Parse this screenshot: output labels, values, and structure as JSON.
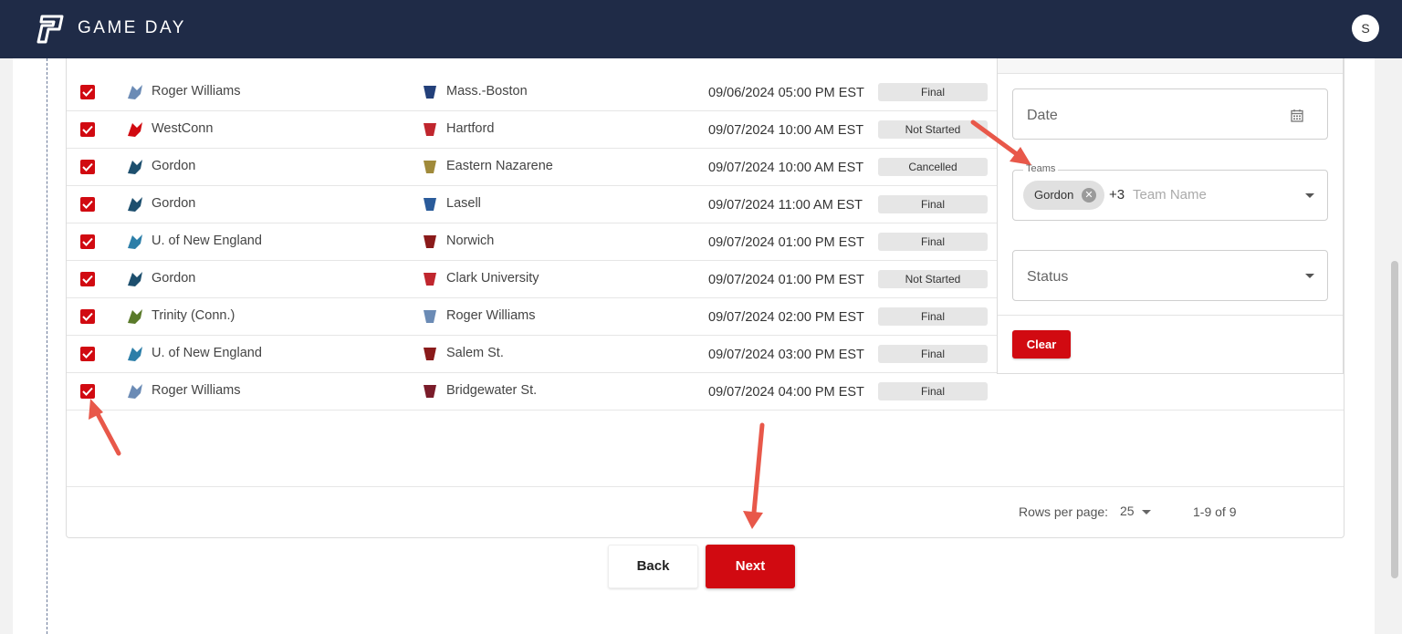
{
  "header": {
    "title": "GAME DAY",
    "avatar_initial": "S"
  },
  "games": [
    {
      "team1": "Roger Williams",
      "team2": "Mass.-Boston",
      "datetime": "09/06/2024 05:00 PM EST",
      "status": "Final",
      "checked": true
    },
    {
      "team1": "WestConn",
      "team2": "Hartford",
      "datetime": "09/07/2024 10:00 AM EST",
      "status": "Not Started",
      "checked": true
    },
    {
      "team1": "Gordon",
      "team2": "Eastern Nazarene",
      "datetime": "09/07/2024 10:00 AM EST",
      "status": "Cancelled",
      "checked": true
    },
    {
      "team1": "Gordon",
      "team2": "Lasell",
      "datetime": "09/07/2024 11:00 AM EST",
      "status": "Final",
      "checked": true
    },
    {
      "team1": "U. of New England",
      "team2": "Norwich",
      "datetime": "09/07/2024 01:00 PM EST",
      "status": "Final",
      "checked": true
    },
    {
      "team1": "Gordon",
      "team2": "Clark University",
      "datetime": "09/07/2024 01:00 PM EST",
      "status": "Not Started",
      "checked": true
    },
    {
      "team1": "Trinity (Conn.)",
      "team2": "Roger Williams",
      "datetime": "09/07/2024 02:00 PM EST",
      "status": "Final",
      "checked": true
    },
    {
      "team1": "U. of New England",
      "team2": "Salem St.",
      "datetime": "09/07/2024 03:00 PM EST",
      "status": "Final",
      "checked": true
    },
    {
      "team1": "Roger Williams",
      "team2": "Bridgewater St.",
      "datetime": "09/07/2024 04:00 PM EST",
      "status": "Final",
      "checked": true
    }
  ],
  "filters": {
    "date_placeholder": "Date",
    "teams_label": "Teams",
    "teams_chip": "Gordon",
    "teams_more": "+3",
    "teams_placeholder": "Team Name",
    "status_placeholder": "Status",
    "clear_label": "Clear"
  },
  "pagination": {
    "rows_per_page_label": "Rows per page:",
    "rows_per_page_value": "25",
    "range": "1-9 of 9"
  },
  "actions": {
    "back_label": "Back",
    "next_label": "Next"
  },
  "colors": {
    "header_bg": "#1f2b47",
    "accent": "#d10a11",
    "annotation_arrow": "#e8584a"
  }
}
